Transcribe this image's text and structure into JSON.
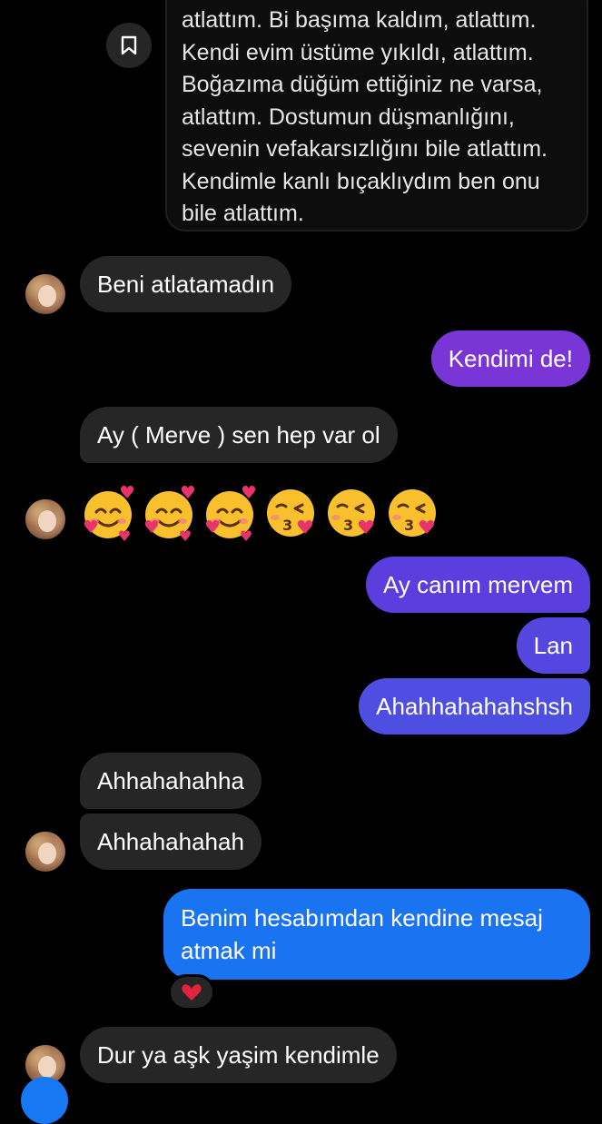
{
  "shared_post": {
    "text": "atlattım. Bi başıma kaldım, atlattım.\nKendi evim üstüme yıkıldı, atlattım.\nBoğazıma düğüm ettiğiniz ne varsa,\natlattım. Dostumun düşmanlığını,\nsevenin vefakarsızlığını bile atlattım.\nKendimle kanlı bıçaklıydım ben onu\nbile atlattım.",
    "save_icon": "bookmark-icon"
  },
  "messages": {
    "m1": "Beni atlatamadın",
    "m2": "Kendimi de!",
    "m3": "Ay ( Merve ) sen hep var ol",
    "m5": "Ay canım mervem",
    "m6": "Lan",
    "m7": "Ahahhahahahshsh",
    "m8": "Ahhahahahha",
    "m9": "Ahhahahahah",
    "m10": "Benim hesabımdan kendine mesaj\natmak mi",
    "m11": "Dur ya aşk yaşim kendimle"
  },
  "emojis": [
    "smiling-face-with-hearts",
    "smiling-face-with-hearts",
    "smiling-face-with-hearts",
    "face-blowing-kiss",
    "face-blowing-kiss",
    "face-blowing-kiss"
  ],
  "reaction": "heart-icon",
  "colors": {
    "incoming": "#262626",
    "outgoing_purple": "#7a35d6",
    "outgoing_indigo": "#5a45de",
    "outgoing_blue": "#1a73f0"
  }
}
